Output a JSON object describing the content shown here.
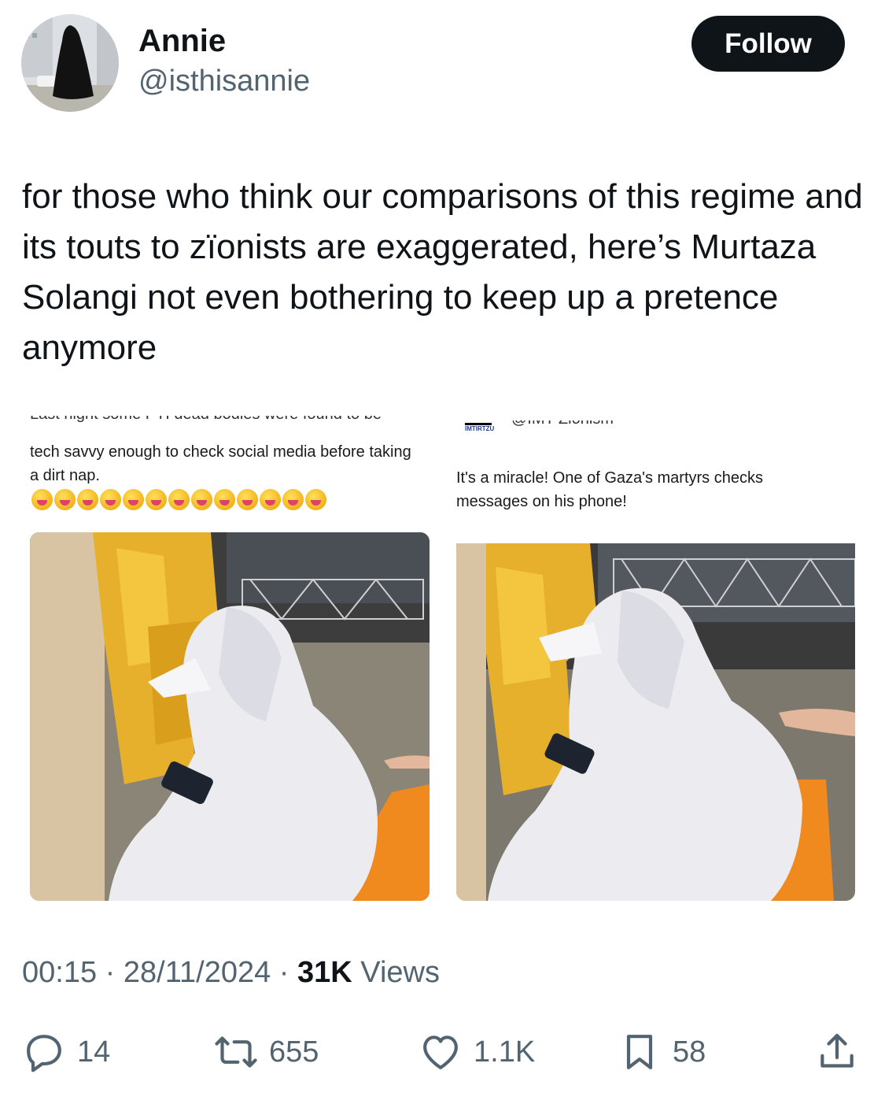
{
  "author": {
    "display_name": "Annie",
    "handle": "@isthisannie",
    "follow_label": "Follow"
  },
  "tweet": {
    "text": "for those who think our comparisons of this regime and its touts to zïonists are exaggerated, here’s Murtaza Solangi not even bothering to keep up a pretence anymore"
  },
  "embedded_left": {
    "cropped_first_line": "Last night some PTI dead bodies were found to be",
    "caption": "tech savvy enough to check social media before taking a dirt nap.",
    "emoji_count": 13
  },
  "embedded_right": {
    "cropped_handle": "@IMT Zionism",
    "logo_text": "IMTIRTZU",
    "caption": "It's a miracle! One of Gaza's martyrs checks messages on his phone!"
  },
  "meta": {
    "time": "00:15",
    "separator1": " · ",
    "date": "28/11/2024",
    "separator2": " · ",
    "views_count": "31K",
    "views_label": " Views"
  },
  "actions": {
    "replies": "14",
    "reposts": "655",
    "likes": "1.1K",
    "bookmarks": "58"
  },
  "colors": {
    "text": "#0f1419",
    "secondary": "#536471",
    "follow_bg": "#0f1419"
  }
}
